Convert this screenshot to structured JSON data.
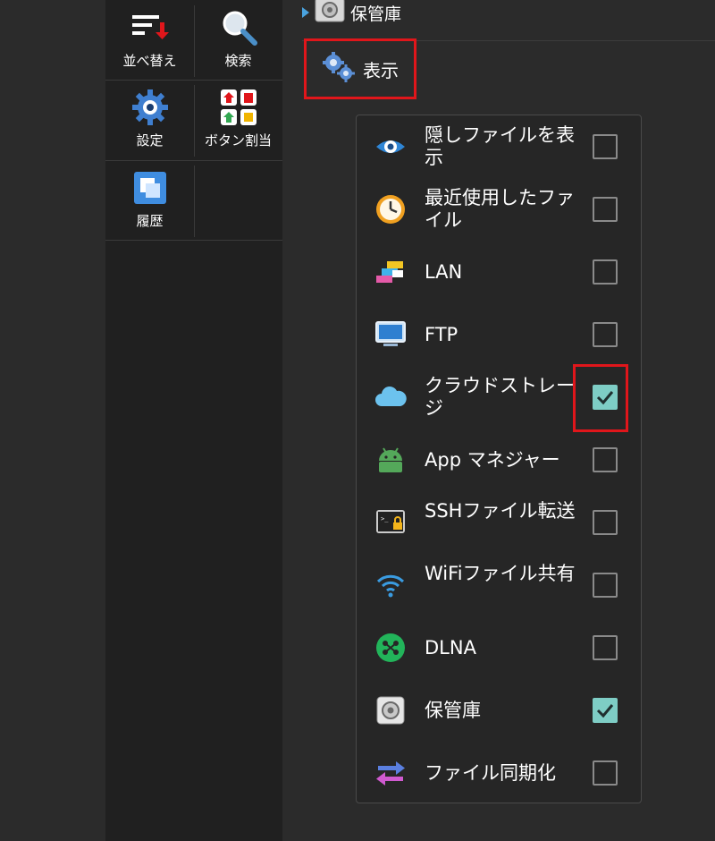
{
  "toolbar": {
    "sort_label": "並べ替え",
    "search_label": "検索",
    "settings_label": "設定",
    "button_assign_label": "ボタン割当",
    "history_label": "履歴"
  },
  "header": {
    "vault_label": "保管庫",
    "view_label": "表示"
  },
  "menu": {
    "items": [
      {
        "label": "隠しファイルを表示",
        "icon": "eye-icon",
        "checked": false
      },
      {
        "label": "最近使用したファイル",
        "icon": "clock-icon",
        "checked": false
      },
      {
        "label": "LAN",
        "icon": "lan-icon",
        "checked": false
      },
      {
        "label": "FTP",
        "icon": "monitor-icon",
        "checked": false
      },
      {
        "label": "クラウドストレージ",
        "icon": "cloud-icon",
        "checked": true
      },
      {
        "label": "App マネジャー",
        "icon": "android-icon",
        "checked": false
      },
      {
        "label": "SSHファイル転送",
        "icon": "terminal-lock-icon",
        "checked": false
      },
      {
        "label": "WiFiファイル共有",
        "icon": "wifi-icon",
        "checked": false
      },
      {
        "label": "DLNA",
        "icon": "dlna-icon",
        "checked": false
      },
      {
        "label": "保管庫",
        "icon": "vault-icon",
        "checked": true
      },
      {
        "label": "ファイル同期化",
        "icon": "sync-arrows-icon",
        "checked": false
      }
    ]
  },
  "colors": {
    "accent_blue": "#4aa3df",
    "checkbox_checked": "#7ecdc5",
    "highlight_red": "#e0161b"
  }
}
